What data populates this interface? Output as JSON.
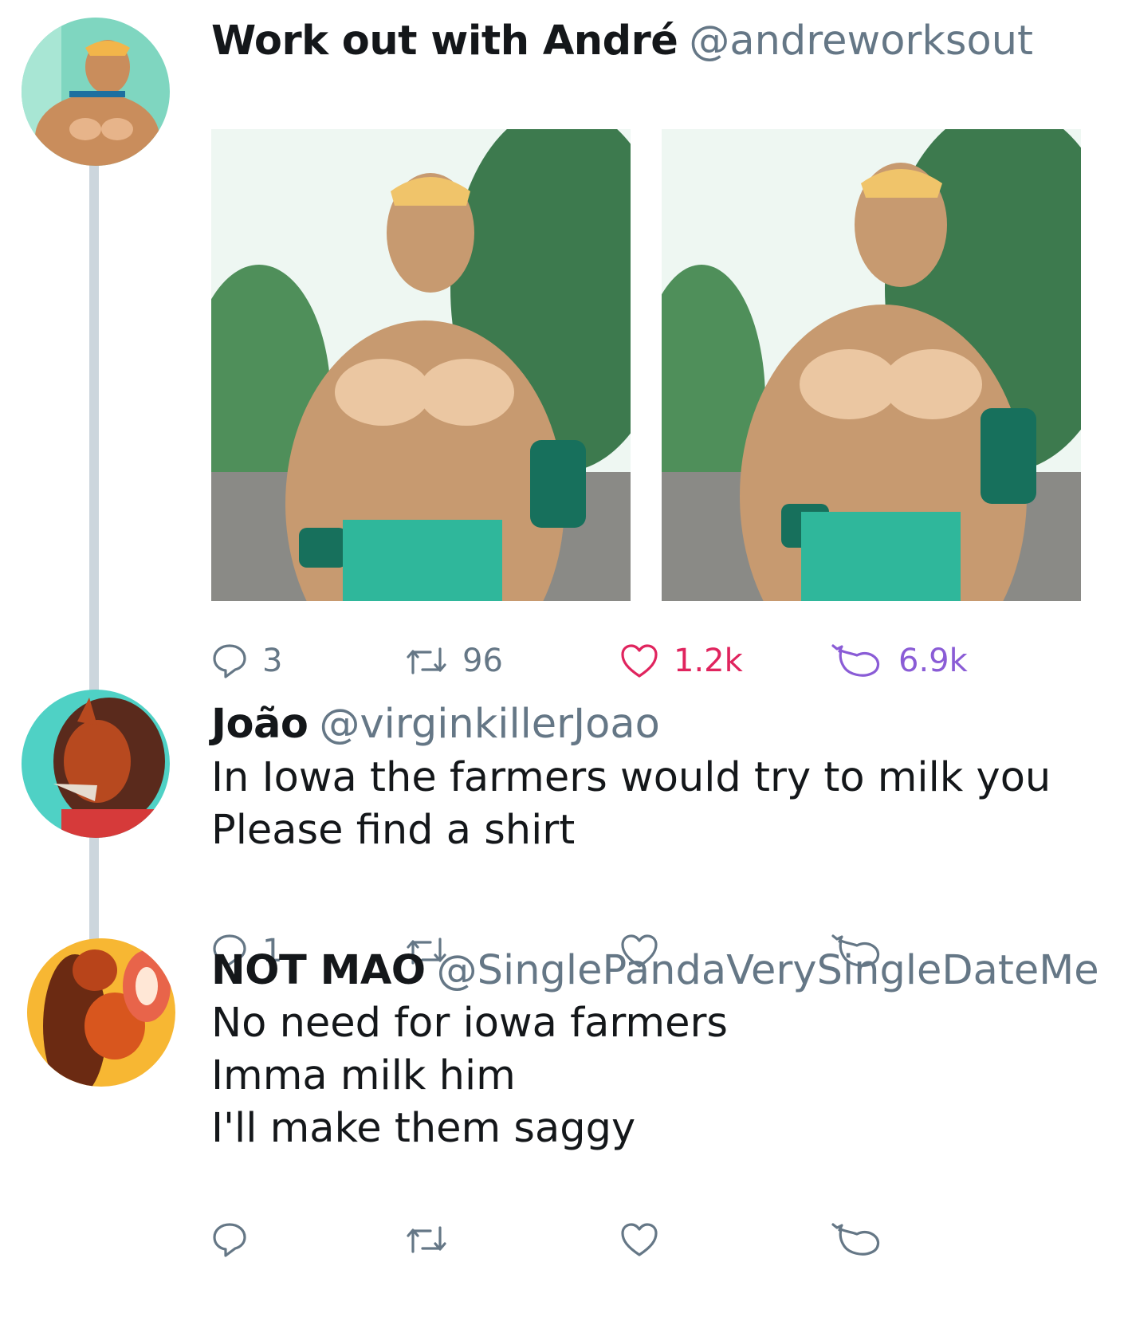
{
  "tweets": [
    {
      "name": "Work out with André",
      "handle": "@andreworksout",
      "lines": [],
      "media_alts": [
        "Illustration: muscular cougar character facing forward",
        "Illustration: muscular cougar character looking to the side"
      ],
      "actions": {
        "reply": "3",
        "retweet": "96",
        "like": "1.2k",
        "eggplant": "6.9k"
      }
    },
    {
      "name": "João",
      "handle": "@virginkillerJoao",
      "lines": [
        "In Iowa the farmers would try to milk you",
        "Please find a shirt"
      ],
      "actions": {
        "reply": "1",
        "retweet": "",
        "like": "",
        "eggplant": ""
      }
    },
    {
      "name": "NOT MAO",
      "handle": "@SinglePandaVerySingleDateMe",
      "lines": [
        "No need for iowa farmers",
        "Imma milk him",
        "I'll make them saggy"
      ],
      "actions": {
        "reply": "",
        "retweet": "",
        "like": "",
        "eggplant": ""
      }
    }
  ],
  "colors": {
    "text": "#14171a",
    "muted": "#657786",
    "like": "#e0245e",
    "eggplant": "#8a5cd6",
    "thread": "#ccd6dd"
  },
  "icons": [
    "reply-icon",
    "retweet-icon",
    "like-icon",
    "eggplant-icon"
  ]
}
